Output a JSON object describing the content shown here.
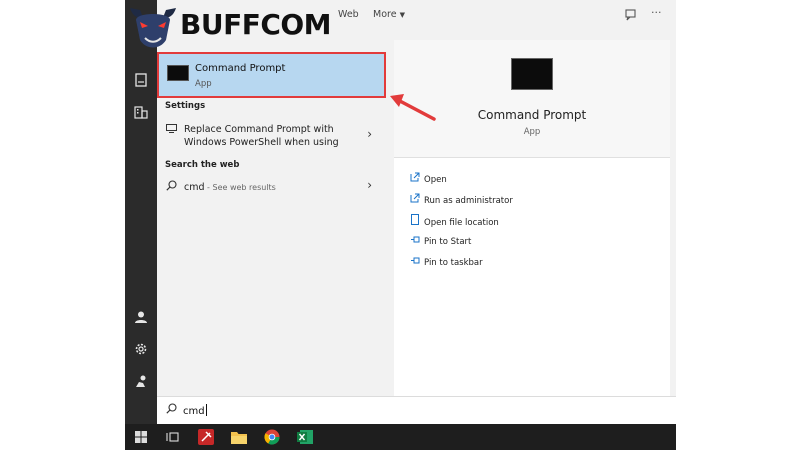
{
  "logo": {
    "text": "BUFFCOM"
  },
  "topbar": {
    "tabs": [
      {
        "label": "Web"
      },
      {
        "label": "More"
      }
    ]
  },
  "results": {
    "best_match": {
      "title": "Command Prompt",
      "subtitle": "App"
    },
    "settings": {
      "heading": "Settings",
      "item": {
        "line1": "Replace Command Prompt with",
        "line2": "Windows PowerShell when using"
      }
    },
    "web": {
      "heading": "Search the web",
      "item": {
        "query": "cmd",
        "suffix": " - See web results"
      }
    }
  },
  "preview": {
    "title": "Command Prompt",
    "subtitle": "App",
    "actions": [
      {
        "label": "Open",
        "icon": "open-icon"
      },
      {
        "label": "Run as administrator",
        "icon": "shield-icon"
      },
      {
        "label": "Open file location",
        "icon": "file-icon"
      },
      {
        "label": "Pin to Start",
        "icon": "pin-icon"
      },
      {
        "label": "Pin to taskbar",
        "icon": "pin-icon"
      }
    ]
  },
  "search": {
    "value": "cmd"
  },
  "colors": {
    "highlight": "#b7d7f0",
    "highlight_border": "#e23b3b",
    "arrow": "#e23b3b",
    "rail": "#2b2b2b",
    "taskbar": "#1e1e1e"
  }
}
